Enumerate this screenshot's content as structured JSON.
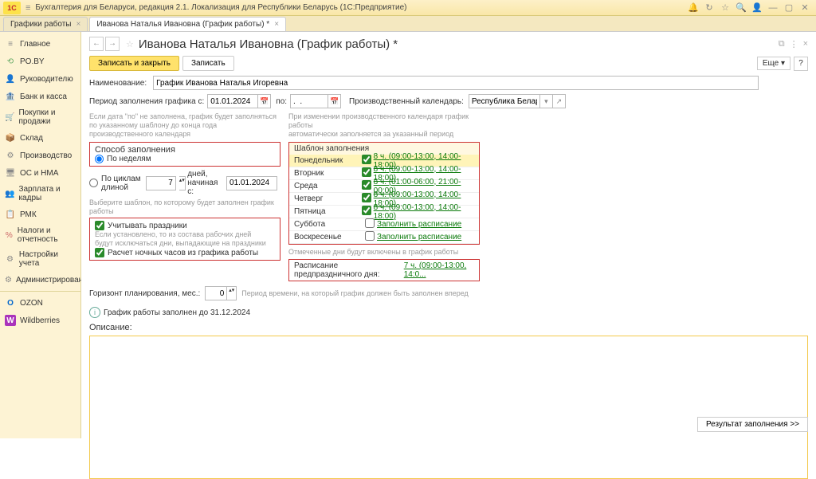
{
  "titlebar": {
    "logo": "1C",
    "title": "Бухгалтерия для Беларуси, редакция 2.1. Локализация для Республики Беларусь   (1С:Предприятие)"
  },
  "tabs": [
    {
      "label": "Графики работы"
    },
    {
      "label": "Иванова Наталья Ивановна (График работы) *"
    }
  ],
  "sidebar": [
    {
      "icon": "≡",
      "label": "Главное",
      "c": "#888"
    },
    {
      "icon": "⟲",
      "label": "PO.BY",
      "c": "#6a6"
    },
    {
      "icon": "👤",
      "label": "Руководителю",
      "c": "#888"
    },
    {
      "icon": "🏦",
      "label": "Банк и касса",
      "c": "#5a8"
    },
    {
      "icon": "🛒",
      "label": "Покупки и продажи",
      "c": "#5a8"
    },
    {
      "icon": "📦",
      "label": "Склад",
      "c": "#c96"
    },
    {
      "icon": "⚙",
      "label": "Производство",
      "c": "#888"
    },
    {
      "icon": "🖥",
      "label": "ОС и НМА",
      "c": "#888"
    },
    {
      "icon": "👥",
      "label": "Зарплата и кадры",
      "c": "#5a8"
    },
    {
      "icon": "📋",
      "label": "РМК",
      "c": "#888"
    },
    {
      "icon": "%",
      "label": "Налоги и отчетность",
      "c": "#c66"
    },
    {
      "icon": "⚙",
      "label": "Настройки учета",
      "c": "#888"
    },
    {
      "icon": "⚙",
      "label": "Администрирование",
      "c": "#888"
    },
    {
      "icon": "O",
      "label": "OZON",
      "c": "#06c"
    },
    {
      "icon": "W",
      "label": "Wildberries",
      "c": "#a3b"
    }
  ],
  "page": {
    "title": "Иванова Наталья Ивановна (График работы) *",
    "save_close": "Записать и закрыть",
    "save": "Записать",
    "more": "Еще ▾",
    "q": "?",
    "name_label": "Наименование:",
    "name_value": "График Иванова Наталья Игоревна",
    "period_label": "Период заполнения графика   с:",
    "date_from": "01.01.2024",
    "to_label": "по:",
    "date_to": ".  .",
    "prod_cal_label": "Производственный календарь:",
    "prod_cal_value": "Республика Беларусь",
    "hint1a": "Если дата \"по\" не заполнена, график будет заполняться",
    "hint1b": "по указанному шаблону до конца года производственного календаря",
    "hint2a": "При изменении производственного календаря график работы",
    "hint2b": "автоматически заполняется за указанный период",
    "fill_method_label": "Способ заполнения",
    "by_weeks": "По неделям",
    "by_cycles": "По циклам длиной",
    "cycle_days": "7",
    "days_from": "дней,   начиная с:",
    "cycle_date": "01.01.2024",
    "select_tmpl": "Выберите шаблон, по которому будет заполнен график работы",
    "chk_holidays": "Учитывать праздники",
    "hint_holidays1": "Если установлено, то из состава рабочих дней",
    "hint_holidays2": "будут исключаться дни, выпадающие на праздники",
    "chk_night": "Расчет ночных часов из графика работы",
    "tmpl_header": "Шаблон заполнения",
    "schedule": [
      {
        "day": "Понедельник",
        "on": true,
        "link": "8 ч. (09:00-13:00, 14:00-18:00)",
        "sel": true
      },
      {
        "day": "Вторник",
        "on": true,
        "link": "8 ч. (09:00-13:00, 14:00-18:00)"
      },
      {
        "day": "Среда",
        "on": true,
        "link": "8 ч. (01:00-06:00, 21:00-00:00)"
      },
      {
        "day": "Четверг",
        "on": true,
        "link": "8 ч. (09:00-13:00, 14:00-18:00)"
      },
      {
        "day": "Пятница",
        "on": true,
        "link": "8 ч. (09:00-13:00, 14:00-18:00)"
      },
      {
        "day": "Суббота",
        "on": false,
        "link": "Заполнить расписание"
      },
      {
        "day": "Воскресенье",
        "on": false,
        "link": "Заполнить расписание"
      }
    ],
    "marked_note": "Отмеченные дни будут включены в график работы",
    "pre_holiday_label": "Расписание предпраздничного дня:",
    "pre_holiday_link": "7 ч. (09:00-13:00, 14:0...",
    "horizon_label": "Горизонт планирования, мес.:",
    "horizon_val": "0",
    "horizon_hint": "Период времени, на который график должен быть заполнен вперед",
    "info_text": "График работы заполнен до 31.12.2024",
    "desc_label": "Описание:",
    "result_btn": "Результат заполнения >>"
  }
}
